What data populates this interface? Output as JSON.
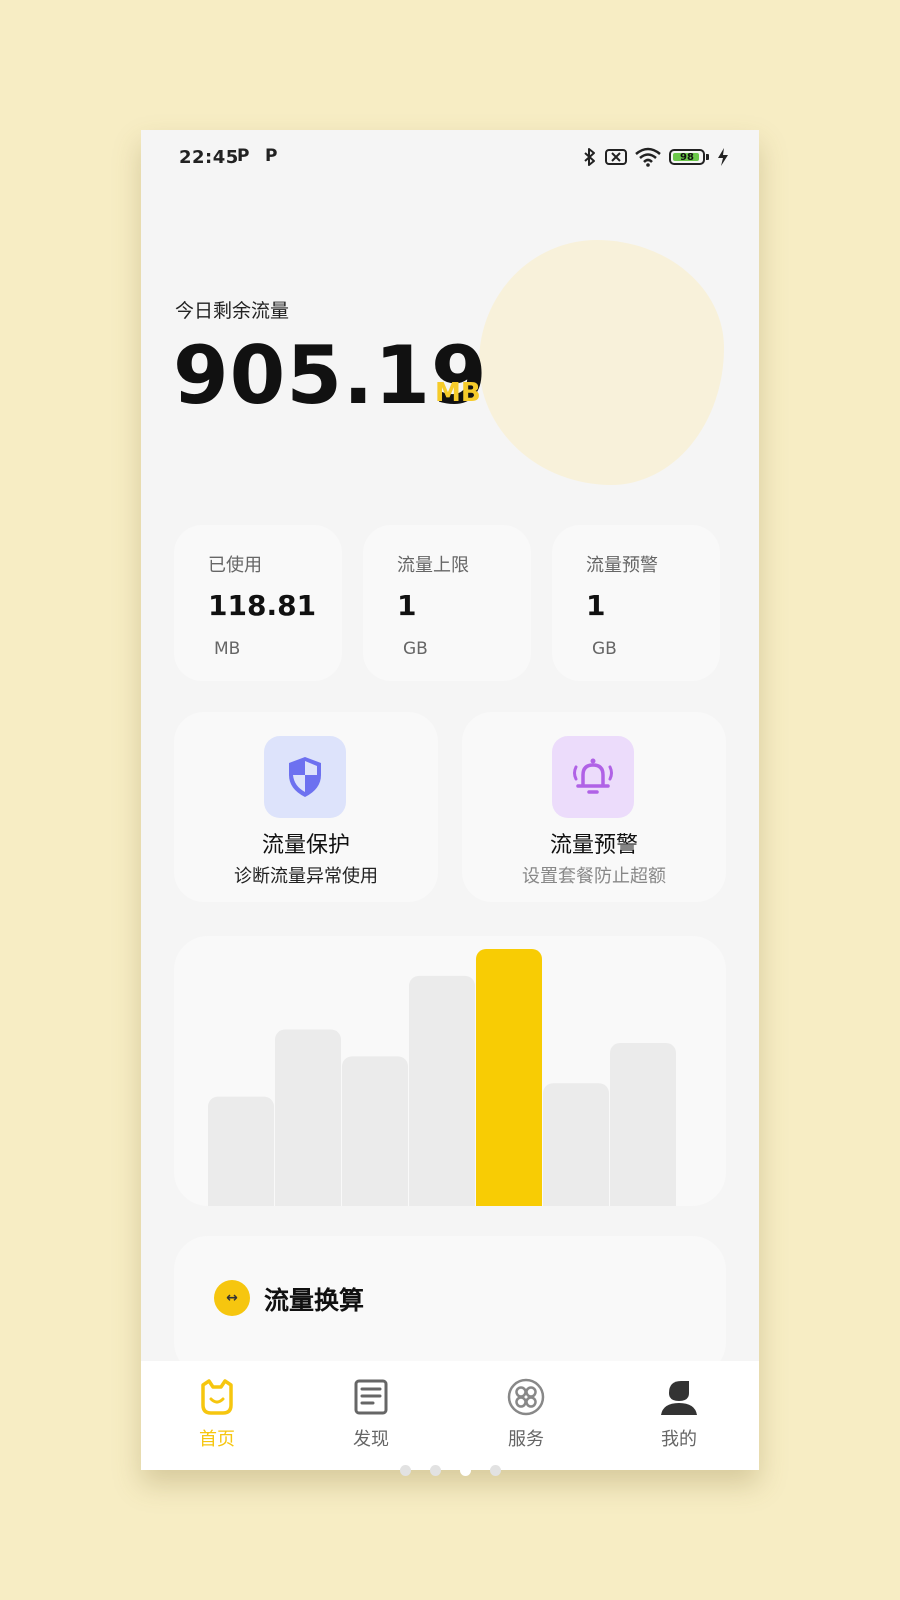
{
  "status_bar": {
    "time": "22:45",
    "p1": "P",
    "p2": "P",
    "battery": "98"
  },
  "hero": {
    "label": "今日剩余流量",
    "value": "905.19",
    "unit": "MB"
  },
  "stats": [
    {
      "label": "已使用",
      "value": "118.81",
      "unit": "MB"
    },
    {
      "label": "流量上限",
      "value": "1",
      "unit": "GB"
    },
    {
      "label": "流量预警",
      "value": "1",
      "unit": "GB"
    }
  ],
  "features": [
    {
      "title": "流量保护",
      "subtitle": "诊断流量异常使用",
      "icon": "shield-icon",
      "icon_bg": "#dde3fb",
      "icon_color": "#6d71f0"
    },
    {
      "title": "流量预警",
      "subtitle": "设置套餐防止超额",
      "icon": "bell-alert-icon",
      "icon_bg": "#ecdcfb",
      "icon_color": "#b062e6"
    }
  ],
  "chart_data": {
    "type": "bar",
    "categories": [
      "",
      "",
      "",
      "",
      "",
      "",
      ""
    ],
    "values": [
      40,
      65,
      55,
      85,
      95,
      45,
      60
    ],
    "highlight_index": 4,
    "colors": {
      "bar": "#ebebeb",
      "highlight": "#f8cc04"
    }
  },
  "conversion": {
    "title": "流量换算",
    "icon": "swap-arrows-icon"
  },
  "tabs": [
    {
      "label": "首页",
      "icon": "home-cat-icon",
      "active": true
    },
    {
      "label": "发现",
      "icon": "document-icon",
      "active": false
    },
    {
      "label": "服务",
      "icon": "clover-icon",
      "active": false
    },
    {
      "label": "我的",
      "icon": "person-icon",
      "active": false
    }
  ],
  "colors": {
    "accent": "#f6c60f",
    "background": "#f7edc4",
    "muted_text": "#8a8a8a"
  },
  "page_indicator": {
    "count": 4,
    "active_index": 2
  }
}
